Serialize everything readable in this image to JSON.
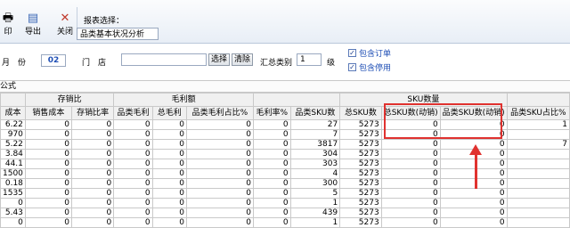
{
  "toolbar": {
    "print_label": "印",
    "export_label": "导出",
    "close_label": "关闭",
    "report_label": "报表选择：",
    "report_value": "品类基本状况分析"
  },
  "filter": {
    "month_label": "月　份",
    "month_value": "02",
    "store_label": "门　店",
    "select_btn": "选择",
    "clear_btn": "清除",
    "summary_label": "汇总类别",
    "summary_value": "1",
    "level_label": "级",
    "include_order": "包含订单",
    "include_disabled": "包含停用",
    "checked_glyph": "✓"
  },
  "formula_bar": "公式",
  "table": {
    "group_headers": [
      "",
      "存销比",
      "毛利额",
      "",
      "SKU数量",
      ""
    ],
    "headers": [
      "成本",
      "销售成本",
      "存销比率",
      "品类毛利",
      "总毛利",
      "品类毛利占比%",
      "毛利率%",
      "品类SKU数",
      "总SKU数",
      "总SKU数(动销)",
      "品类SKU数(动销)",
      "品类SKU占比%"
    ],
    "rows": [
      [
        "6.22",
        "0",
        "0",
        "0",
        "0",
        "0",
        "0",
        "27",
        "5273",
        "0",
        "0",
        "1"
      ],
      [
        "970",
        "0",
        "0",
        "0",
        "0",
        "0",
        "0",
        "7",
        "5273",
        "0",
        "0",
        ""
      ],
      [
        "5.22",
        "0",
        "0",
        "0",
        "0",
        "0",
        "0",
        "3817",
        "5273",
        "0",
        "0",
        "7"
      ],
      [
        "3.84",
        "0",
        "0",
        "0",
        "0",
        "0",
        "0",
        "304",
        "5273",
        "0",
        "0",
        ""
      ],
      [
        "44.1",
        "0",
        "0",
        "0",
        "0",
        "0",
        "0",
        "303",
        "5273",
        "0",
        "0",
        ""
      ],
      [
        "1500",
        "0",
        "0",
        "0",
        "0",
        "0",
        "0",
        "4",
        "5273",
        "0",
        "0",
        ""
      ],
      [
        "0.18",
        "0",
        "0",
        "0",
        "0",
        "0",
        "0",
        "300",
        "5273",
        "0",
        "0",
        ""
      ],
      [
        "1535",
        "0",
        "0",
        "0",
        "0",
        "0",
        "0",
        "5",
        "5273",
        "0",
        "0",
        ""
      ],
      [
        "0",
        "0",
        "0",
        "0",
        "0",
        "0",
        "0",
        "1",
        "5273",
        "0",
        "0",
        ""
      ],
      [
        "5.43",
        "0",
        "0",
        "0",
        "0",
        "0",
        "0",
        "439",
        "5273",
        "0",
        "0",
        ""
      ],
      [
        "0",
        "0",
        "0",
        "0",
        "0",
        "0",
        "0",
        "1",
        "5273",
        "0",
        "0",
        ""
      ]
    ]
  },
  "annotation": {
    "color": "#e0322f"
  }
}
